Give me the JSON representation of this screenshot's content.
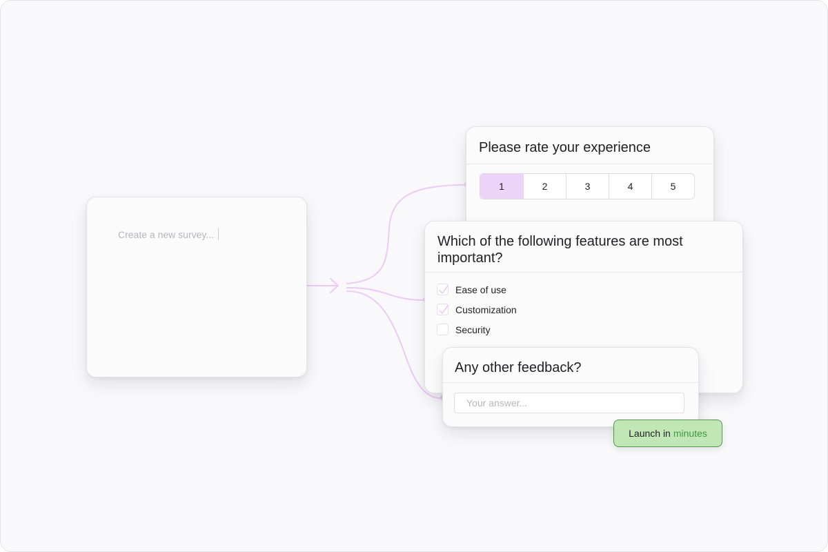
{
  "creator": {
    "placeholder": "Create a new survey..."
  },
  "rating_question": {
    "title": "Please rate your experience",
    "options": [
      "1",
      "2",
      "3",
      "4",
      "5"
    ],
    "selected": "1"
  },
  "features_question": {
    "title": "Which of the following features are most important?",
    "options": [
      {
        "label": "Ease of use",
        "checked": true
      },
      {
        "label": "Customization",
        "checked": true
      },
      {
        "label": "Security",
        "checked": false
      }
    ]
  },
  "feedback_question": {
    "title": "Any other feedback?",
    "placeholder": "Your answer..."
  },
  "launch_badge": {
    "prefix": "Launch in",
    "highlight": "minutes"
  },
  "colors": {
    "accent_purple": "#ecd3f8",
    "connector_purple": "#eec9f7",
    "badge_green_bg": "#c2e7b7",
    "badge_green_border": "#4c9946",
    "badge_green_text": "#3f9a3b"
  },
  "icons": [
    "arrow-right-icon",
    "checkmark-icon",
    "text-caret-icon"
  ]
}
